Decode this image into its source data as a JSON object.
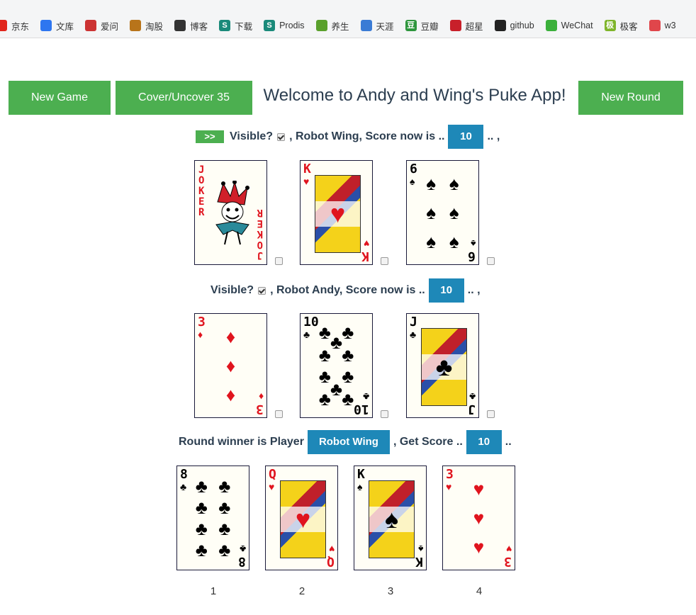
{
  "bookmarks": [
    {
      "label": "京东",
      "icon": "jd-icon",
      "color": "#e1251b"
    },
    {
      "label": "文库",
      "icon": "paw-icon",
      "color": "#2e76f0"
    },
    {
      "label": "爱问",
      "icon": "avatar-icon",
      "color": "#c33"
    },
    {
      "label": "淘股",
      "icon": "horse-icon",
      "color": "#b8741a"
    },
    {
      "label": "博客",
      "icon": "script-icon",
      "color": "#333"
    },
    {
      "label": "下载",
      "icon": "s-icon",
      "color": "#1a8a7a",
      "glyph": "S"
    },
    {
      "label": "Prodis",
      "icon": "s-icon",
      "color": "#1a8a7a",
      "glyph": "S"
    },
    {
      "label": "养生",
      "icon": "leaf-icon",
      "color": "#5aa02c"
    },
    {
      "label": "天涯",
      "icon": "globe-icon",
      "color": "#3a7bd5"
    },
    {
      "label": "豆瓣",
      "icon": "douban-icon",
      "color": "#2e963d",
      "glyph": "豆"
    },
    {
      "label": "超星",
      "icon": "star-icon",
      "color": "#c8202a"
    },
    {
      "label": "github",
      "icon": "github-icon",
      "color": "#222"
    },
    {
      "label": "WeChat",
      "icon": "wechat-icon",
      "color": "#3bb03b"
    },
    {
      "label": "极客",
      "icon": "jike-icon",
      "color": "#7fb52a",
      "glyph": "极"
    },
    {
      "label": "w3",
      "icon": "owl-icon",
      "color": "#e0464b"
    }
  ],
  "header": {
    "new_game": "New Game",
    "cover_uncover": "Cover/Uncover 35",
    "welcome": "Welcome to Andy and Wing's Puke App!",
    "new_round": "New Round"
  },
  "wing": {
    "arrow": ">>",
    "visible_label": "Visible?",
    "player_text": ", Robot Wing, Score now is ..",
    "score": "10",
    "trail": ".. ,",
    "cards": [
      {
        "rank": "JOKER",
        "suit": "",
        "color": "red",
        "type": "joker"
      },
      {
        "rank": "K",
        "suit": "♥",
        "color": "red",
        "type": "face"
      },
      {
        "rank": "6",
        "suit": "♠",
        "color": "black",
        "type": "pips"
      }
    ]
  },
  "andy": {
    "visible_label": "Visible?",
    "player_text": ", Robot Andy, Score now is ..",
    "score": "10",
    "trail": ".. ,",
    "cards": [
      {
        "rank": "3",
        "suit": "♦",
        "color": "red",
        "type": "pips"
      },
      {
        "rank": "10",
        "suit": "♣",
        "color": "black",
        "type": "pips"
      },
      {
        "rank": "J",
        "suit": "♣",
        "color": "black",
        "type": "face"
      }
    ]
  },
  "round": {
    "winner_text": "Round winner is Player",
    "winner": "Robot Wing",
    "get_score_text": ", Get Score ..",
    "score": "10",
    "trail": "..",
    "cards": [
      {
        "rank": "8",
        "suit": "♣",
        "color": "black",
        "type": "pips",
        "num": "1"
      },
      {
        "rank": "Q",
        "suit": "♥",
        "color": "red",
        "type": "face",
        "num": "2"
      },
      {
        "rank": "K",
        "suit": "♠",
        "color": "black",
        "type": "face",
        "num": "3"
      },
      {
        "rank": "3",
        "suit": "♥",
        "color": "red",
        "type": "pips",
        "num": "4"
      }
    ]
  }
}
